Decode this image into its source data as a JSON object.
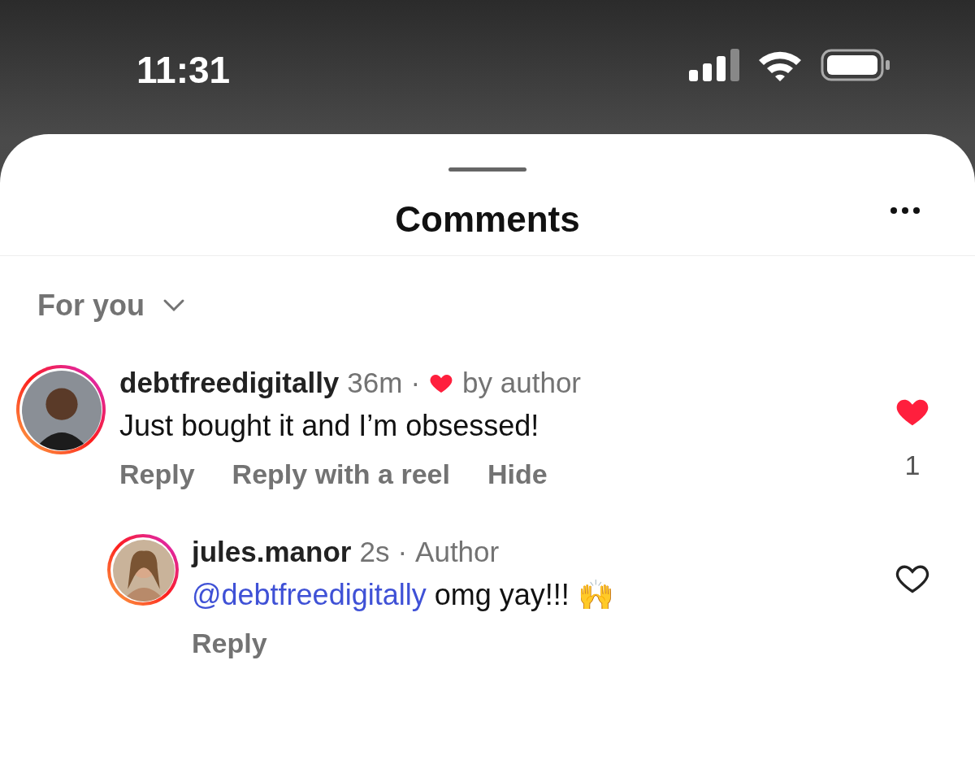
{
  "status_bar": {
    "time": "11:31"
  },
  "sheet": {
    "title": "Comments"
  },
  "filter": {
    "label": "For you"
  },
  "comments": [
    {
      "username": "debtfreedigitally",
      "time": "36m",
      "separator": "·",
      "liked_by_author": true,
      "author_like_text": "by author",
      "text": "Just bought it and I’m obsessed!",
      "actions": [
        "Reply",
        "Reply with a reel",
        "Hide"
      ],
      "liked": true,
      "like_count": "1",
      "replies": [
        {
          "username": "jules.manor",
          "time": "2s",
          "separator": "·",
          "badge": "Author",
          "mention": "@debtfreedigitally",
          "text": "omg yay!!! 🙌",
          "actions": [
            "Reply"
          ],
          "liked": false
        }
      ]
    }
  ]
}
